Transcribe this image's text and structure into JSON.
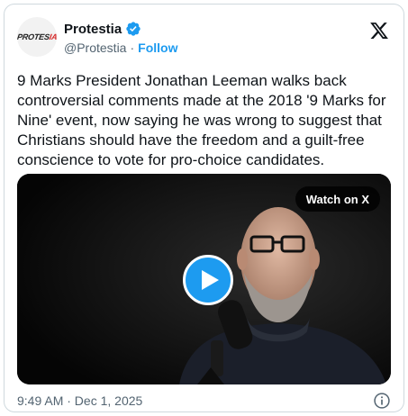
{
  "author": {
    "name": "Protestia",
    "handle": "@Protestia",
    "separator": "·",
    "follow_label": "Follow",
    "avatar_logo_main": "PROTES",
    "avatar_logo_accent": "IA",
    "verified_icon": "verified-badge-icon"
  },
  "tweet": {
    "text": "9 Marks President Jonathan Leeman walks back controversial comments made at the 2018 '9 Marks for Nine' event, now saying he was wrong to suggest that Christians should have the freedom and a guilt-free conscience to vote for pro-choice candidates."
  },
  "media": {
    "watch_label": "Watch on X",
    "play_icon": "play-icon"
  },
  "footer": {
    "timestamp": "9:49 AM · Dec 1, 2025",
    "info_icon": "info-icon"
  },
  "colors": {
    "accent": "#1d9bf0",
    "text": "#0f1419",
    "muted": "#536471",
    "border": "#cfd9de"
  }
}
